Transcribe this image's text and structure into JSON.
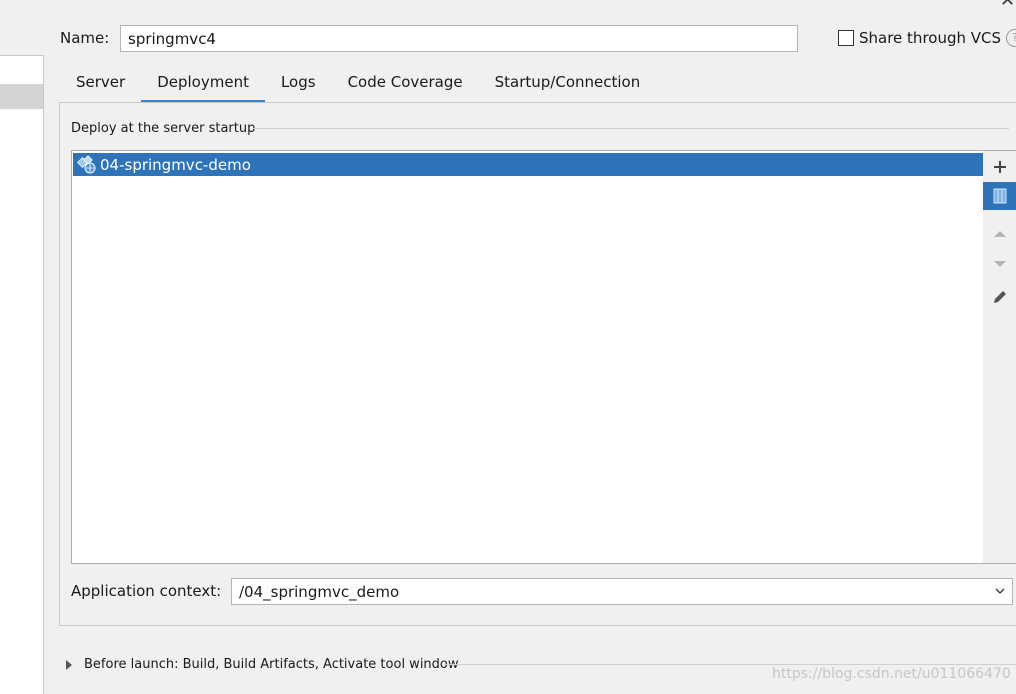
{
  "config": {
    "name_label": "Name:",
    "name_value": "springmvc4",
    "share_vcs_label": "Share through VCS",
    "share_vcs_checked": false
  },
  "tabs": [
    {
      "label": "Server",
      "active": false
    },
    {
      "label": "Deployment",
      "active": true
    },
    {
      "label": "Logs",
      "active": false
    },
    {
      "label": "Code Coverage",
      "active": false
    },
    {
      "label": "Startup/Connection",
      "active": false
    }
  ],
  "deployment": {
    "section_title": "Deploy at the server startup",
    "items": [
      {
        "label": "04-springmvc-demo",
        "icon": "artifact-icon",
        "selected": true
      }
    ],
    "toolbar": [
      "add-icon",
      "artifact-icon",
      "move-up-icon",
      "move-down-icon",
      "edit-icon"
    ],
    "app_context_label": "Application context:",
    "app_context_value": "/04_springmvc_demo"
  },
  "before_launch": {
    "label": "Before launch: Build, Build Artifacts, Activate tool window"
  },
  "watermark": "https://blog.csdn.net/u011066470",
  "colors": {
    "accent": "#4083c9",
    "selection": "#2f73b8",
    "background": "#f0f0f0"
  }
}
